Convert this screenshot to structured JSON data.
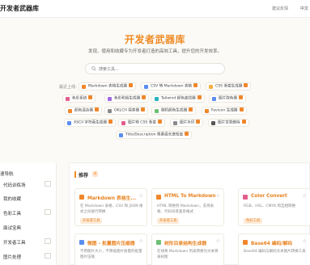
{
  "header": {
    "title": "开发者武器库",
    "feedback": "建议反馈",
    "lang": "中文"
  },
  "hero": {
    "title": "开发者武器库",
    "subtitle": "发现、使用和收藏专为开发者打造的高效工具，提升您的开发效率。"
  },
  "search": {
    "placeholder": "搜索工具..."
  },
  "quick_access": {
    "label": "最近上线:",
    "items": [
      {
        "label": "Markdown 表格生成器",
        "icon_color": "#f0862a"
      },
      {
        "label": "CSV 转 Markdown 表格",
        "icon_color": "#5b8def"
      },
      {
        "label": "CSS 渐变生成器",
        "icon_color": "#f6b042"
      },
      {
        "label": "色彩系统",
        "icon_color": "#e25d8d"
      },
      {
        "label": "色彩和谐生成器",
        "icon_color": "#a06be0"
      },
      {
        "label": "Tailwind 颜色查找器",
        "icon_color": "#2bb3c0"
      },
      {
        "label": "图片取色器",
        "icon_color": "#5b8def"
      },
      {
        "label": "颜色混合器",
        "icon_color": "#f0862a"
      },
      {
        "label": "OKLCH 探索器",
        "icon_color": "#8a8a8a"
      },
      {
        "label": "随机颜色生成器",
        "icon_color": "#6fbf73"
      },
      {
        "label": "Favicon 生成器",
        "icon_color": "#f0862a"
      },
      {
        "label": "ASCII 字符画生成器",
        "icon_color": "#5b8def"
      },
      {
        "label": "图片转 CSS 渐变",
        "icon_color": "#e25d8d"
      },
      {
        "label": "图片水印",
        "icon_color": "#8a8a8a"
      },
      {
        "label": "图片背景删除",
        "icon_color": "#555555"
      },
      {
        "label": "Title/Description 像素级长度检查",
        "icon_color": "#5b8def"
      }
    ]
  },
  "sidebar": {
    "title": "速导航",
    "items": [
      {
        "label": "代码训练场"
      },
      {
        "label": "我的收藏"
      },
      {
        "label": "色彩工具"
      },
      {
        "label": "面试宝典"
      },
      {
        "label": "开发者工具"
      },
      {
        "label": "图片处理"
      }
    ]
  },
  "panel": {
    "title": "推荐",
    "badge": "8",
    "cards": [
      {
        "title": "Markdown 表格生...",
        "desc": "在 Markdown 表格、CSV 和 JSON 格式之间进行转换",
        "tag": "开发者工具",
        "icon_color": "#f0862a"
      },
      {
        "title": "HTML To Markdown",
        "desc": "HTML 转换到 Markdown，支持表格、代码块等复杂格式",
        "tag": "开发者工具",
        "icon_color": "#f0862a"
      },
      {
        "title": "Color Convert",
        "desc": "RGB、HSL、CMYK 和互相转换",
        "tag": "色彩工具",
        "icon_color": "#e25d8d"
      },
      {
        "title": "微图 - 批量图片压缩器",
        "desc": "不用图片大小，不降低图片质量的批量图片压缩",
        "tag": "",
        "icon_color": "#5b8def"
      },
      {
        "title": "树形目录结构生成器",
        "desc": "在线将 Markdown 列表转换为文本目录树图",
        "tag": "",
        "icon_color": "#6fbf73"
      },
      {
        "title": "Base64 编码/解码",
        "desc": "Base64 编码与解码文本图片转换工具",
        "tag": "",
        "icon_color": "#f0862a"
      }
    ]
  }
}
